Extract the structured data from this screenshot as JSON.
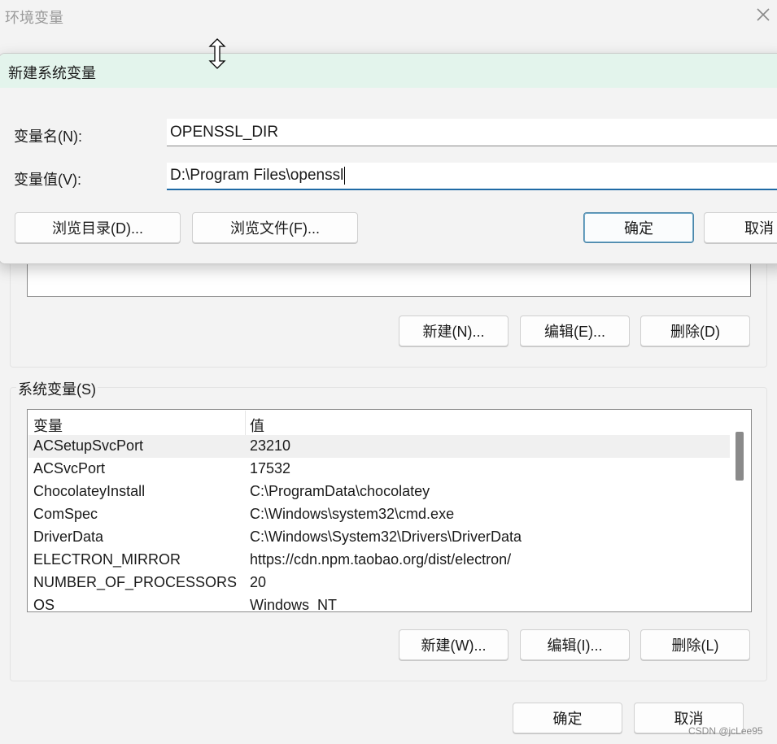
{
  "outer_window": {
    "title": "环境变量",
    "close_icon": "close-icon"
  },
  "user_vars_buttons": {
    "new": "新建(N)...",
    "edit": "编辑(E)...",
    "delete": "删除(D)"
  },
  "system_vars": {
    "label": "系统变量(S)",
    "columns": [
      "变量",
      "值"
    ],
    "rows": [
      {
        "name": "ACSetupSvcPort",
        "value": "23210"
      },
      {
        "name": "ACSvcPort",
        "value": "17532"
      },
      {
        "name": "ChocolateyInstall",
        "value": "C:\\ProgramData\\chocolatey"
      },
      {
        "name": "ComSpec",
        "value": "C:\\Windows\\system32\\cmd.exe"
      },
      {
        "name": "DriverData",
        "value": "C:\\Windows\\System32\\Drivers\\DriverData"
      },
      {
        "name": "ELECTRON_MIRROR",
        "value": "https://cdn.npm.taobao.org/dist/electron/"
      },
      {
        "name": "NUMBER_OF_PROCESSORS",
        "value": "20"
      },
      {
        "name": "OS",
        "value": "Windows_NT"
      }
    ],
    "buttons": {
      "new": "新建(W)...",
      "edit": "编辑(I)...",
      "delete": "删除(L)"
    }
  },
  "footer": {
    "ok": "确定",
    "cancel": "取消"
  },
  "dialog": {
    "title": "新建系统变量",
    "name_label": "变量名(N):",
    "name_value": "OPENSSL_DIR",
    "value_label": "变量值(V):",
    "value_value": "D:\\Program Files\\openssl",
    "browse_dir": "浏览目录(D)...",
    "browse_file": "浏览文件(F)...",
    "ok": "确定",
    "cancel": "取消"
  },
  "watermark": "CSDN @jcLee95",
  "colors": {
    "dialog_titlebar": "#e3f4ec",
    "focus_accent": "#1f6aa5",
    "primary_button_border": "#4a85a8"
  }
}
